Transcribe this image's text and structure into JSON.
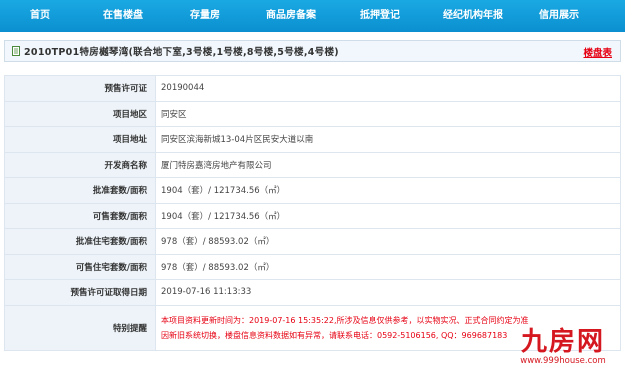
{
  "nav": {
    "items": [
      {
        "label": "首页"
      },
      {
        "label": "在售楼盘"
      },
      {
        "label": "存量房"
      },
      {
        "label": "商品房备案"
      },
      {
        "label": "抵押登记"
      },
      {
        "label": "经纪机构年报"
      },
      {
        "label": "信用展示"
      }
    ]
  },
  "project": {
    "title": "2010TP01特房樾琴湾(联合地下室,3号楼,1号楼,8号楼,5号楼,4号楼)",
    "table_link": "楼盘表",
    "icon": "document-icon"
  },
  "rows": [
    {
      "key": "预售许可证",
      "value": "20190044"
    },
    {
      "key": "项目地区",
      "value": "同安区"
    },
    {
      "key": "项目地址",
      "value": "同安区滨海新城13-04片区民安大道以南"
    },
    {
      "key": "开发商名称",
      "value": "厦门特房嘉湾房地产有限公司"
    },
    {
      "key": "批准套数/面积",
      "value": "1904（套）/ 121734.56（㎡）"
    },
    {
      "key": "可售套数/面积",
      "value": "1904（套）/ 121734.56（㎡）"
    },
    {
      "key": "批准住宅套数/面积",
      "value": "978（套）/ 88593.02（㎡）"
    },
    {
      "key": "可售住宅套数/面积",
      "value": "978（套）/ 88593.02（㎡）"
    },
    {
      "key": "预售许可证取得日期",
      "value": "2019-07-16 11:13:33"
    }
  ],
  "notice": {
    "key": "特别提醒",
    "line1": "本项目资料更新时间为：2019-07-16 15:35:22,所涉及信息仅供参考，以实物实况、正式合同约定为准",
    "line2": "因新旧系统切换，楼盘信息资料数据如有异常，请联系电话：0592-5106156, QQ：969687183"
  },
  "watermark": {
    "logo": "九房网",
    "url": "www.999house.com"
  },
  "colors": {
    "nav_bg": "#0b8fd0",
    "link_red": "#e60012",
    "label_bg": "#edf3f8"
  }
}
